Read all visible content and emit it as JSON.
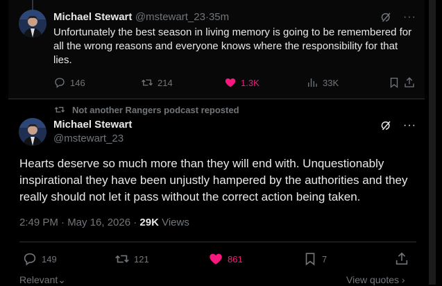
{
  "top_tweet": {
    "display_name": "Michael Stewart",
    "handle": "@mstewart_23",
    "separator": "·",
    "time": "35m",
    "text": "Unfortunately the best season in living memory is going to be remembered for all the wrong reasons and everyone knows where the responsibility for that lies.",
    "more_label": "···",
    "stats": {
      "replies": "146",
      "reposts": "214",
      "likes": "1.3K",
      "views": "33K"
    }
  },
  "main_tweet": {
    "repost_label": "Not another Rangers podcast reposted",
    "display_name": "Michael Stewart",
    "handle": "@mstewart_23",
    "more_label": "···",
    "text": "Hearts deserve so much more than they will end with. Unquestionably inspirational they have been unjustly hampered by the authorities and they really should not let it pass without the correct action being taken.",
    "timestamp": "2:49 PM · May 16, 2026 · ",
    "views_count": "29K",
    "views_label": " Views",
    "stats": {
      "replies": "149",
      "reposts": "121",
      "likes": "861",
      "bookmarks": "7"
    }
  },
  "footer": {
    "sort_label": "Relevant",
    "view_quotes_label": "View quotes"
  },
  "colors": {
    "background": "#000000",
    "text": "#e7e9ea",
    "muted": "#71767b",
    "like": "#f91880",
    "border": "#2f3336"
  },
  "icons": [
    "grok-icon",
    "more-icon",
    "reply-icon",
    "repost-icon",
    "heart-icon",
    "views-icon",
    "bookmark-icon",
    "share-icon",
    "chevron-down-icon",
    "chevron-right-icon"
  ]
}
